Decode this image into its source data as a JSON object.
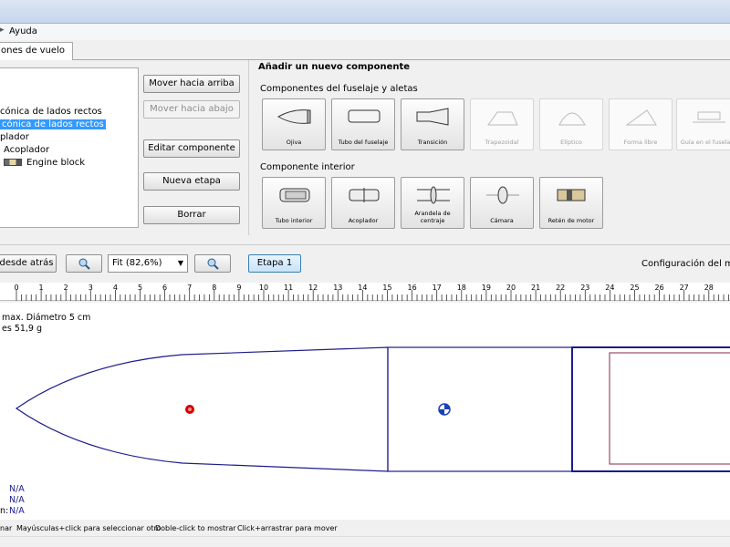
{
  "menu": {
    "arrow": "▸",
    "help_label": "Ayuda"
  },
  "tabs": {
    "flight_config": "ones de vuelo"
  },
  "tree": {
    "items": [
      {
        "label": "cónica de lados rectos",
        "selected": false
      },
      {
        "label": "cónica de lados rectos",
        "selected": true
      },
      {
        "label": "plador",
        "selected": false
      },
      {
        "label": "Acoplador",
        "selected": false
      },
      {
        "label": "Engine block",
        "selected": false
      }
    ]
  },
  "actions": {
    "move_up": "Mover hacia arriba",
    "move_down": "Mover hacia abajo",
    "edit": "Editar componente",
    "new_stage": "Nueva etapa",
    "delete": "Borrar"
  },
  "add_panel": {
    "title": "Añadir un nuevo componente",
    "body_section": "Componentes del fuselaje y aletas",
    "inner_section": "Componente interior",
    "body_components": [
      {
        "label": "Ojiva",
        "enabled": true,
        "icon": "nose-cone-icon"
      },
      {
        "label": "Tubo del fuselaje",
        "enabled": true,
        "icon": "body-tube-icon"
      },
      {
        "label": "Transición",
        "enabled": true,
        "icon": "transition-icon"
      },
      {
        "label": "Trapezoidal",
        "enabled": false,
        "icon": "trapezoidal-fin-icon"
      },
      {
        "label": "Elíptico",
        "enabled": false,
        "icon": "elliptical-fin-icon"
      },
      {
        "label": "Forma libre",
        "enabled": false,
        "icon": "freeform-fin-icon"
      },
      {
        "label": "Guía en el fuselaje",
        "enabled": false,
        "icon": "launch-lug-icon"
      }
    ],
    "inner_components": [
      {
        "label": "Tubo interior",
        "icon": "inner-tube-icon"
      },
      {
        "label": "Acoplador",
        "icon": "coupler-icon"
      },
      {
        "label": "Arandela de centraje",
        "icon": "centering-ring-icon"
      },
      {
        "label": "Cámara",
        "icon": "bulkhead-icon"
      },
      {
        "label": "Retén de motor",
        "icon": "engine-block-icon"
      }
    ]
  },
  "view_toolbar": {
    "view_button": "desde atrás",
    "zoom_value": "Fit (82,6%)",
    "stage_button": "Etapa 1",
    "config_label": "Configuración del motor"
  },
  "ruler": {
    "ticks": [
      "0",
      "1",
      "2",
      "3",
      "4",
      "5",
      "6",
      "7",
      "8",
      "9",
      "10",
      "11",
      "12",
      "13",
      "14",
      "15",
      "16",
      "17",
      "18",
      "19",
      "20",
      "21",
      "22",
      "23",
      "24",
      "25",
      "26",
      "27",
      "28"
    ]
  },
  "info": {
    "line1": "max. Diámetro 5 cm",
    "line2": "es 51,9 g",
    "na1": "N/A",
    "na2": "N/A",
    "na3_prefix": "n:",
    "na3": "N/A"
  },
  "status": {
    "hint1": "nar",
    "hint2": "Mayúsculas+click para seleccionar otro",
    "hint3": "Doble-click to mostrar",
    "hint4": "Click+arrastrar para mover"
  },
  "colors": {
    "rocket_outline": "#1c1c8c",
    "cp_marker": "#d40000",
    "cg_marker": "#1a3fbf",
    "selection": "#3399ff"
  }
}
